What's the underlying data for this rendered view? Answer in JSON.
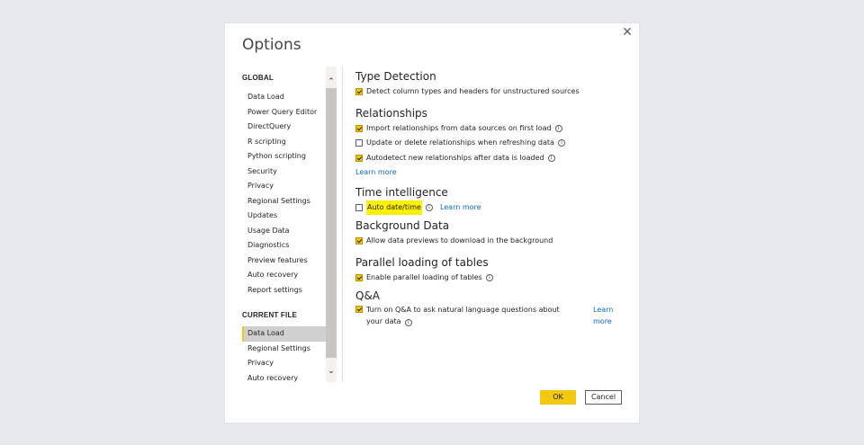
{
  "dialog": {
    "title": "Options",
    "close_icon": "✕"
  },
  "nav": {
    "global_heading": "GLOBAL",
    "global_items": [
      "Data Load",
      "Power Query Editor",
      "DirectQuery",
      "R scripting",
      "Python scripting",
      "Security",
      "Privacy",
      "Regional Settings",
      "Updates",
      "Usage Data",
      "Diagnostics",
      "Preview features",
      "Auto recovery",
      "Report settings"
    ],
    "current_heading": "CURRENT FILE",
    "current_items": [
      "Data Load",
      "Regional Settings",
      "Privacy",
      "Auto recovery"
    ],
    "selected": "current:Data Load"
  },
  "content": {
    "type_detection": {
      "title": "Type Detection",
      "detect": "Detect column types and headers for unstructured sources"
    },
    "relationships": {
      "title": "Relationships",
      "import": "Import relationships from data sources on first load",
      "update": "Update or delete relationships when refreshing data",
      "autodetect": "Autodetect new relationships after data is loaded",
      "learn_more": "Learn more"
    },
    "time_intelligence": {
      "title": "Time intelligence",
      "auto_date": "Auto date/time",
      "learn_more": "Learn more"
    },
    "background_data": {
      "title": "Background Data",
      "allow": "Allow data previews to download in the background"
    },
    "parallel_loading": {
      "title": "Parallel loading of tables",
      "enable": "Enable parallel loading of tables"
    },
    "qa": {
      "title": "Q&A",
      "line1": "Turn on Q&A to ask natural language questions about",
      "line2": "your data",
      "learn": "Learn",
      "more": "more"
    }
  },
  "buttons": {
    "ok": "OK",
    "cancel": "Cancel"
  },
  "colors": {
    "accent": "#f2c811",
    "link": "#0f6cbd",
    "highlight": "#fff100"
  }
}
